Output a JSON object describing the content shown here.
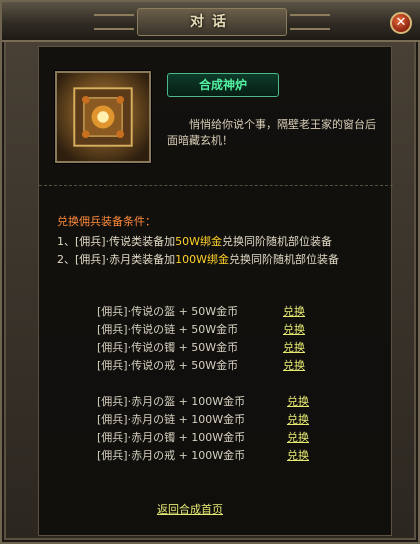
{
  "window": {
    "title": "对话",
    "close_label": "✕"
  },
  "npc": {
    "name": "合成神炉"
  },
  "intro": "悄悄给你说个事，隔壁老王家的窗台后面暗藏玄机！",
  "conditions": {
    "title": "兑换佣兵装备条件：",
    "lines": [
      {
        "prefix": "1、[佣兵]·传说类装备加",
        "highlight": "50W绑金",
        "suffix": "兑换同阶随机部位装备"
      },
      {
        "prefix": "2、[佣兵]·赤月类装备加",
        "highlight": "100W绑金",
        "suffix": "兑换同阶随机部位装备"
      }
    ]
  },
  "exchange": {
    "legend": [
      {
        "item": "[佣兵]·传说の盔 + 50W金币",
        "link": "兑换"
      },
      {
        "item": "[佣兵]·传说の链 + 50W金币",
        "link": "兑换"
      },
      {
        "item": "[佣兵]·传说の镯 + 50W金币",
        "link": "兑换"
      },
      {
        "item": "[佣兵]·传说の戒 + 50W金币",
        "link": "兑换"
      }
    ],
    "moon": [
      {
        "item": "[佣兵]·赤月の盔 + 100W金币",
        "link": "兑换"
      },
      {
        "item": "[佣兵]·赤月の链 + 100W金币",
        "link": "兑换"
      },
      {
        "item": "[佣兵]·赤月の镯 + 100W金币",
        "link": "兑换"
      },
      {
        "item": "[佣兵]·赤月の戒 + 100W金币",
        "link": "兑换"
      }
    ]
  },
  "back_link": "返回合成首页"
}
